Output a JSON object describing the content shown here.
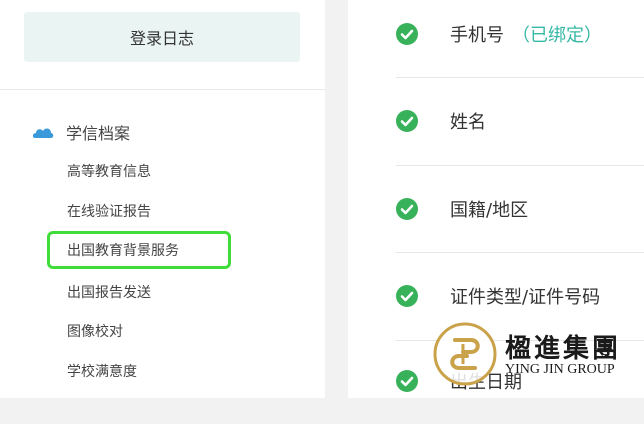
{
  "left_nav": {
    "login_log_button": "登录日志",
    "section_title": "学信档案",
    "items": [
      "高等教育信息",
      "在线验证报告",
      "出国教育背景服务",
      "出国报告发送",
      "图像校对",
      "学校满意度"
    ],
    "highlighted_item": "出国教育背景服务"
  },
  "profile_fields": [
    {
      "label": "手机号",
      "status": "（已绑定）"
    },
    {
      "label": "姓名"
    },
    {
      "label": "国籍/地区"
    },
    {
      "label": "证件类型/证件号码"
    },
    {
      "label": "出生日期"
    }
  ],
  "watermark": {
    "name_cn": "楹進集團",
    "name_en": "YING JIN GROUP"
  },
  "colors": {
    "check_green": "#37b25a",
    "highlight_border": "#3fdc3a",
    "status_teal": "#36b8a5",
    "section_icon": "#3a9ad9",
    "logo_gold": "#c9a24a"
  }
}
